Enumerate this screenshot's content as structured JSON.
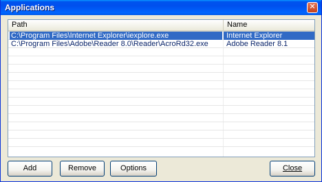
{
  "window": {
    "title": "Applications",
    "close_glyph": "✕"
  },
  "list": {
    "columns": [
      "Path",
      "Name"
    ],
    "rows": [
      {
        "path": "C:\\Program Files\\Internet Explorer\\iexplore.exe",
        "name": "Internet Explorer",
        "selected": true
      },
      {
        "path": "C:\\Program Files\\Adobe\\Reader 8.0\\Reader\\AcroRd32.exe",
        "name": "Adobe Reader 8.1",
        "selected": false
      }
    ]
  },
  "buttons": {
    "add": "Add",
    "remove": "Remove",
    "options": "Options",
    "close": "Close"
  },
  "colors": {
    "selection": "#316ac5",
    "titlebar": "#0053ee"
  }
}
